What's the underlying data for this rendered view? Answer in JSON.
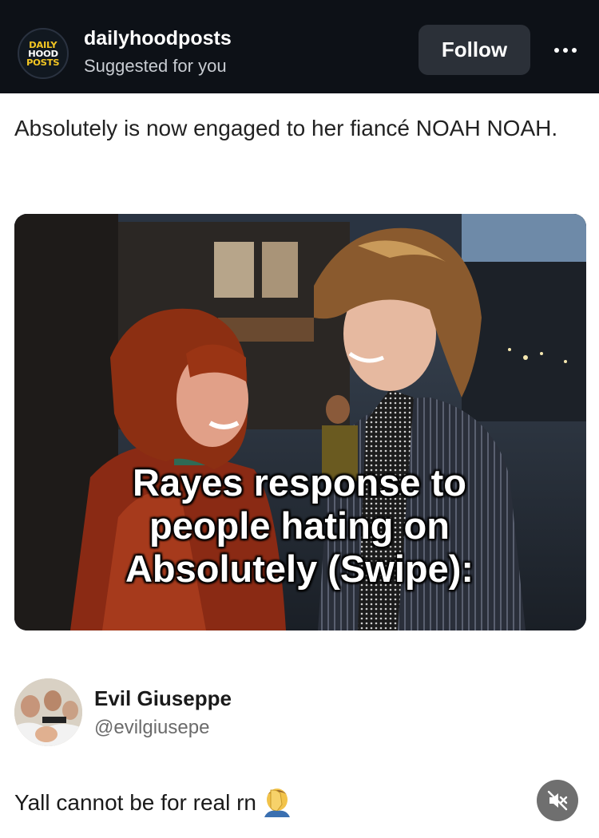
{
  "header": {
    "logo_lines": [
      "DAILY",
      "HOOD",
      "POSTS"
    ],
    "account_handle": "dailyhoodposts",
    "subtitle": "Suggested for you",
    "follow_label": "Follow",
    "more_icon": "more-horizontal-icon"
  },
  "post": {
    "caption": "Absolutely is now engaged to her fiancé NOAH NOAH.",
    "image_overlay_text": "Rayes response to\npeople hating on\nAbsolutely (Swipe):"
  },
  "tweet": {
    "author_name": "Evil Giuseppe",
    "author_handle": "@evilgiusepe",
    "text": "Yall cannot be for real rn",
    "emoji_icon": "facepalm-icon",
    "mute_icon": "speaker-muted-icon"
  },
  "colors": {
    "header_bg": "#0d1117",
    "logo_yellow": "#f3c623",
    "follow_bg": "#2b3038"
  }
}
